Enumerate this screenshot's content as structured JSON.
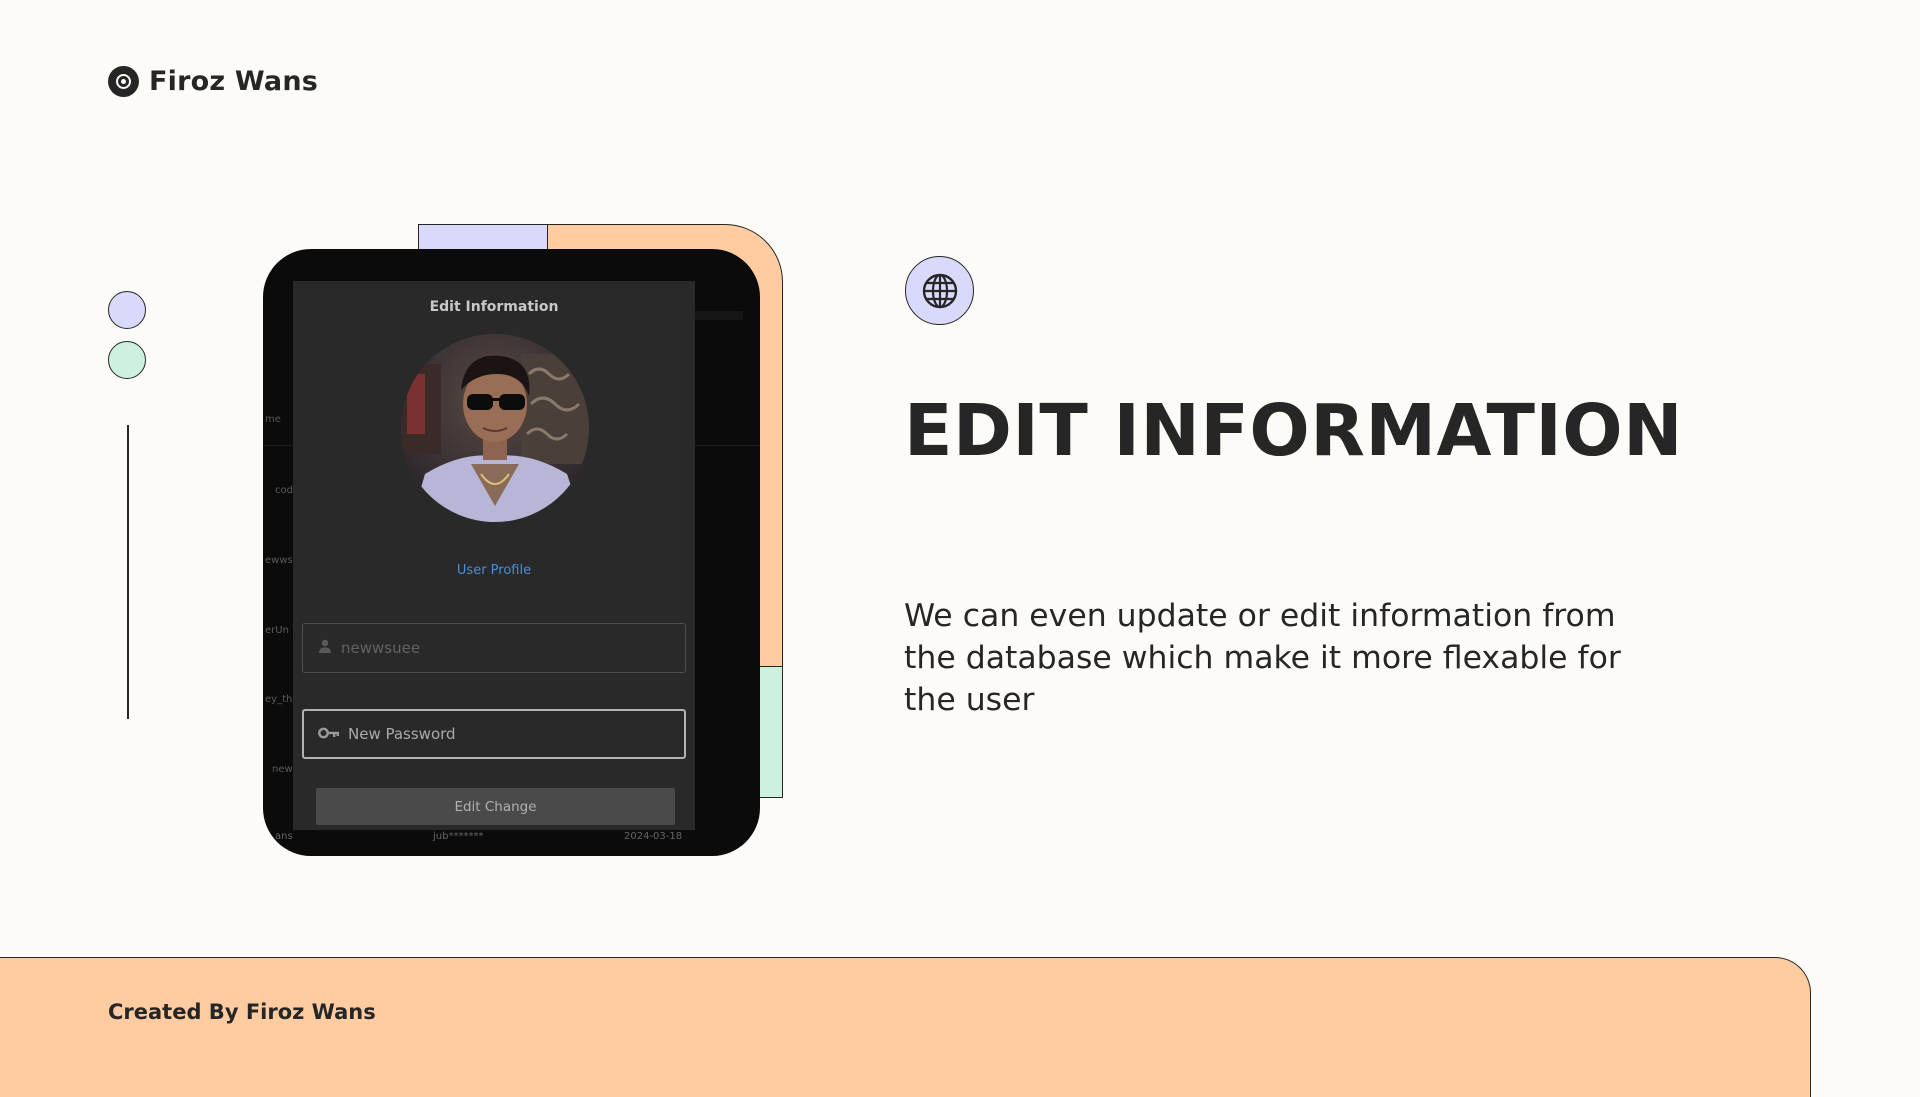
{
  "brand": {
    "name": "Firoz Wans",
    "icon": "target-circle-icon"
  },
  "decorations": {
    "dot_colors": [
      "#d9d9fb",
      "#ccf1df"
    ],
    "accent_peach": "#ffcba1"
  },
  "modal": {
    "title": "Edit Information",
    "profile_link": "User Profile",
    "username_placeholder": "newwsuee",
    "username_icon": "person-icon",
    "password_placeholder": "New Password",
    "password_icon": "key-icon",
    "submit_label": "Edit Change"
  },
  "background_table": {
    "row_fragments": [
      "me",
      "cod",
      "ewws",
      "erUn",
      "ey_th",
      "new"
    ],
    "bottom_row": {
      "name": "ans",
      "password": "jub*******",
      "date": "2024-03-18"
    }
  },
  "hero": {
    "icon": "globe-icon",
    "heading": "EDIT INFORMATION",
    "description": "We can even update or edit information from the database which make it more flexable for the user"
  },
  "footer": {
    "credit": "Created By Firoz Wans"
  }
}
